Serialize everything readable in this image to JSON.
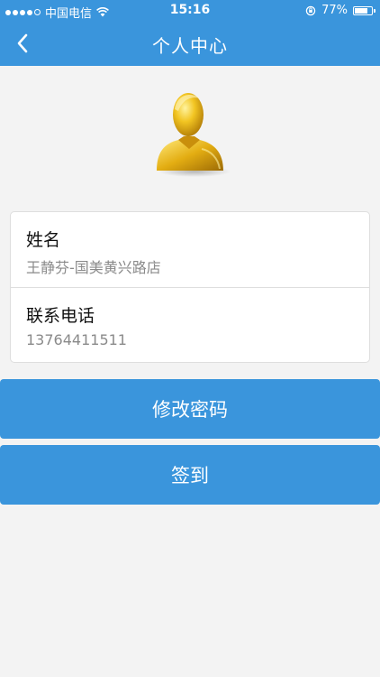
{
  "status_bar": {
    "carrier": "中国电信",
    "time": "15:16",
    "battery": "77%",
    "battery_level": 0.77
  },
  "header": {
    "title": "个人中心",
    "back_icon": "chevron-left-icon"
  },
  "profile": {
    "avatar_icon": "user-avatar-icon",
    "fields": [
      {
        "label": "姓名",
        "value": "王静芬-国美黄兴路店"
      },
      {
        "label": "联系电话",
        "value": "13764411511"
      }
    ]
  },
  "actions": {
    "change_password": "修改密码",
    "sign_in": "签到"
  },
  "colors": {
    "accent": "#3a95dc",
    "background": "#f3f3f3"
  }
}
